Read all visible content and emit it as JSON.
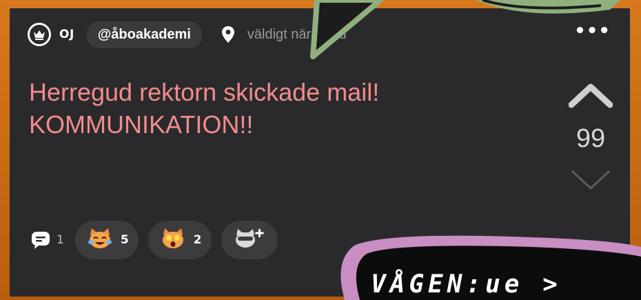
{
  "post": {
    "author": "OJ",
    "handle": "@åboakademi",
    "location": "väldigt nära • 7d",
    "more_label": "•••",
    "text_lines": [
      "Herregud rektorn skickade mail!",
      "KOMMUNIKATION!!"
    ]
  },
  "vote": {
    "count": "99"
  },
  "footer": {
    "comment_count": "1",
    "reactions": [
      {
        "icon": "laughing-cat-icon",
        "count": "5"
      },
      {
        "icon": "shocked-cat-icon",
        "count": "2"
      }
    ],
    "add_reaction_label": "+"
  },
  "overlay": {
    "bubble_text": "VÅGEN:ue >"
  },
  "colors": {
    "card": "#2a2a2c",
    "post_text": "#f28c8c",
    "pill": "#3a3a3d",
    "frame": "#c46a12",
    "green_bubble": "#8fb07e",
    "pink_bubble": "#c98ec2"
  }
}
